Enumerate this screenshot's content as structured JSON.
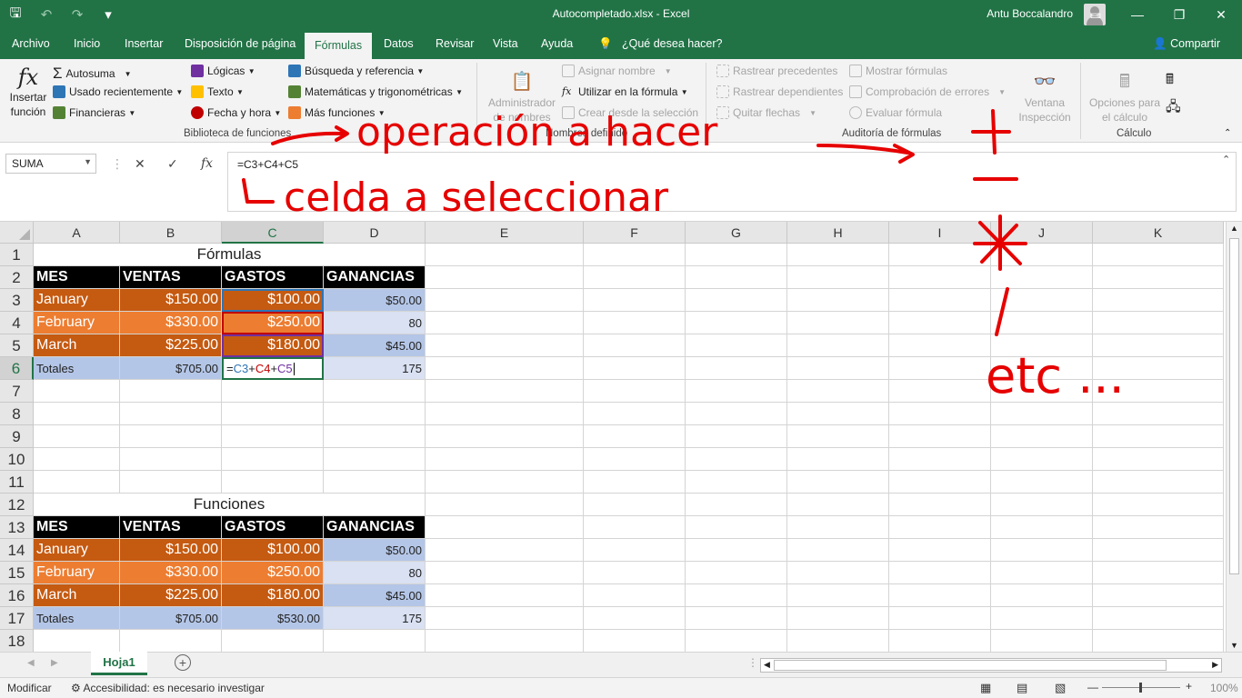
{
  "window": {
    "title": "Autocompletado.xlsx  -  Excel",
    "user": "Antu Boccalandro"
  },
  "tabs": [
    "Archivo",
    "Inicio",
    "Insertar",
    "Disposición de página",
    "Fórmulas",
    "Datos",
    "Revisar",
    "Vista",
    "Ayuda"
  ],
  "tell_me": "¿Qué desea hacer?",
  "share": "Compartir",
  "ribbon": {
    "insert_function": [
      "Insertar",
      "función"
    ],
    "autosum": "Autosuma",
    "recent": "Usado recientemente",
    "financial": "Financieras",
    "logical": "Lógicas",
    "text": "Texto",
    "datetime": "Fecha y hora",
    "lookup": "Búsqueda y referencia",
    "math": "Matemáticas y trigonométricas",
    "more": "Más funciones",
    "group_library": "Biblioteca de funciones",
    "name_manager": [
      "Administrador",
      "de nombres"
    ],
    "define_name": "Asignar nombre",
    "use_in_formula": "Utilizar en la fórmula",
    "create_from_sel": "Crear desde la selección",
    "group_names": "Nombres definido",
    "trace_prec": "Rastrear precedentes",
    "trace_dep": "Rastrear dependientes",
    "remove_arrows": "Quitar flechas",
    "show_formulas": "Mostrar fórmulas",
    "error_check": "Comprobación de errores",
    "eval_formula": "Evaluar fórmula",
    "group_audit": "Auditoría de fórmulas",
    "watch_window": [
      "Ventana",
      "Inspección"
    ],
    "calc_options": [
      "Opciones para",
      "el cálculo"
    ],
    "group_calc": "Cálculo"
  },
  "formula_bar": {
    "name_box": "SUMA",
    "formula": "=C3+C4+C5"
  },
  "columns": [
    "A",
    "B",
    "C",
    "D",
    "E",
    "F",
    "G",
    "H",
    "I",
    "J",
    "K"
  ],
  "rows": [
    "1",
    "2",
    "3",
    "4",
    "5",
    "6",
    "7",
    "8",
    "9",
    "10",
    "11",
    "12",
    "13",
    "14",
    "15",
    "16",
    "17",
    "18"
  ],
  "sheet": {
    "title1": "Fórmulas",
    "title2": "Funciones",
    "headers": [
      "MES",
      "VENTAS",
      "GASTOS",
      "GANANCIAS"
    ],
    "table1": [
      [
        "January",
        "$150.00",
        "$100.00",
        "$50.00"
      ],
      [
        "February",
        "$330.00",
        "$250.00",
        "80"
      ],
      [
        "March",
        "$225.00",
        "$180.00",
        "$45.00"
      ],
      [
        "Totales",
        "$705.00",
        "",
        "175"
      ]
    ],
    "active_formula_parts": [
      "=",
      "C3",
      "+",
      "C4",
      "+",
      "C5"
    ],
    "table2": [
      [
        "January",
        "$150.00",
        "$100.00",
        "$50.00"
      ],
      [
        "February",
        "$330.00",
        "$250.00",
        "80"
      ],
      [
        "March",
        "$225.00",
        "$180.00",
        "$45.00"
      ],
      [
        "Totales",
        "$705.00",
        "$530.00",
        "175"
      ]
    ]
  },
  "sheet_tab": "Hoja1",
  "status": {
    "mode": "Modificar",
    "accessibility": "Accesibilidad: es necesario investigar",
    "zoom": "100%"
  },
  "annotations": {
    "line1": "operación a hacer",
    "line2": "celda a seleccionar",
    "ops": [
      "+",
      "-",
      "*",
      "/",
      "etc ..."
    ]
  }
}
